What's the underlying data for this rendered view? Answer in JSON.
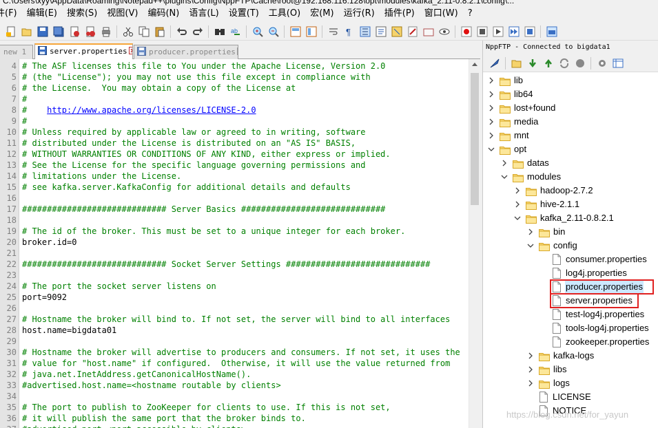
{
  "window": {
    "title": "C:\\Users\\xyy\\AppData\\Roaming\\Notepad++\\plugins\\Config\\NppFTP\\Cache\\root@192.168.116.128\\opt\\modules\\kafka_2.11-0.8.2.1\\config\\..."
  },
  "menu": [
    "件(F)",
    "编辑(E)",
    "搜索(S)",
    "视图(V)",
    "编码(N)",
    "语言(L)",
    "设置(T)",
    "工具(O)",
    "宏(M)",
    "运行(R)",
    "插件(P)",
    "窗口(W)",
    "?"
  ],
  "tabs": [
    {
      "label": "new 1",
      "active": false
    },
    {
      "label": "server.properties",
      "active": true
    },
    {
      "label": "producer.properties",
      "active": false
    }
  ],
  "editor": {
    "lines": [
      {
        "n": "4",
        "text": "# The ASF licenses this file to You under the Apache License, Version 2.0",
        "kind": "comment"
      },
      {
        "n": "5",
        "text": "# (the \"License\"); you may not use this file except in compliance with",
        "kind": "comment"
      },
      {
        "n": "6",
        "text": "# the License.  You may obtain a copy of the License at",
        "kind": "comment"
      },
      {
        "n": "7",
        "text": "#",
        "kind": "comment"
      },
      {
        "n": "8",
        "text": "#    ",
        "kind": "url",
        "url": "http://www.apache.org/licenses/LICENSE-2.0"
      },
      {
        "n": "9",
        "text": "#",
        "kind": "comment"
      },
      {
        "n": "10",
        "text": "# Unless required by applicable law or agreed to in writing, software",
        "kind": "comment"
      },
      {
        "n": "11",
        "text": "# distributed under the License is distributed on an \"AS IS\" BASIS,",
        "kind": "comment"
      },
      {
        "n": "12",
        "text": "# WITHOUT WARRANTIES OR CONDITIONS OF ANY KIND, either express or implied.",
        "kind": "comment"
      },
      {
        "n": "13",
        "text": "# See the License for the specific language governing permissions and",
        "kind": "comment"
      },
      {
        "n": "14",
        "text": "# limitations under the License.",
        "kind": "comment"
      },
      {
        "n": "15",
        "text": "# see kafka.server.KafkaConfig for additional details and defaults",
        "kind": "comment"
      },
      {
        "n": "16",
        "text": "",
        "kind": "plain"
      },
      {
        "n": "17",
        "text": "############################# Server Basics #############################",
        "kind": "comment"
      },
      {
        "n": "18",
        "text": "",
        "kind": "plain"
      },
      {
        "n": "19",
        "text": "# The id of the broker. This must be set to a unique integer for each broker.",
        "kind": "comment"
      },
      {
        "n": "20",
        "text": "broker.id=0",
        "kind": "plain"
      },
      {
        "n": "21",
        "text": "",
        "kind": "plain"
      },
      {
        "n": "22",
        "text": "############################# Socket Server Settings #############################",
        "kind": "comment"
      },
      {
        "n": "23",
        "text": "",
        "kind": "plain"
      },
      {
        "n": "24",
        "text": "# The port the socket server listens on",
        "kind": "comment"
      },
      {
        "n": "25",
        "text": "port=9092",
        "kind": "plain"
      },
      {
        "n": "26",
        "text": "",
        "kind": "plain"
      },
      {
        "n": "27",
        "text": "# Hostname the broker will bind to. If not set, the server will bind to all interfaces",
        "kind": "comment"
      },
      {
        "n": "28",
        "text": "host.name=bigdata01",
        "kind": "plain"
      },
      {
        "n": "29",
        "text": "",
        "kind": "plain"
      },
      {
        "n": "30",
        "text": "# Hostname the broker will advertise to producers and consumers. If not set, it uses the",
        "kind": "comment"
      },
      {
        "n": "31",
        "text": "# value for \"host.name\" if configured.  Otherwise, it will use the value returned from",
        "kind": "comment"
      },
      {
        "n": "32",
        "text": "# java.net.InetAddress.getCanonicalHostName().",
        "kind": "comment"
      },
      {
        "n": "33",
        "text": "#advertised.host.name=<hostname routable by clients>",
        "kind": "comment"
      },
      {
        "n": "34",
        "text": "",
        "kind": "plain"
      },
      {
        "n": "35",
        "text": "# The port to publish to ZooKeeper for clients to use. If this is not set,",
        "kind": "comment"
      },
      {
        "n": "36",
        "text": "# it will publish the same port that the broker binds to.",
        "kind": "comment"
      },
      {
        "n": "37",
        "text": "#advertised.port=<port accessible by clients>",
        "kind": "comment"
      }
    ]
  },
  "ftp": {
    "header": "NppFTP - Connected to bigdata1",
    "tree": [
      {
        "label": "lib",
        "type": "folder",
        "depth": 0,
        "expanded": false
      },
      {
        "label": "lib64",
        "type": "folder",
        "depth": 0,
        "expanded": false
      },
      {
        "label": "lost+found",
        "type": "folder",
        "depth": 0,
        "expanded": false
      },
      {
        "label": "media",
        "type": "folder",
        "depth": 0,
        "expanded": false
      },
      {
        "label": "mnt",
        "type": "folder",
        "depth": 0,
        "expanded": false
      },
      {
        "label": "opt",
        "type": "folder",
        "depth": 0,
        "expanded": true
      },
      {
        "label": "datas",
        "type": "folder",
        "depth": 1,
        "expanded": false
      },
      {
        "label": "modules",
        "type": "folder",
        "depth": 1,
        "expanded": true
      },
      {
        "label": "hadoop-2.7.2",
        "type": "folder",
        "depth": 2,
        "expanded": false
      },
      {
        "label": "hive-2.1.1",
        "type": "folder",
        "depth": 2,
        "expanded": false
      },
      {
        "label": "kafka_2.11-0.8.2.1",
        "type": "folder",
        "depth": 2,
        "expanded": true
      },
      {
        "label": "bin",
        "type": "folder",
        "depth": 3,
        "expanded": false
      },
      {
        "label": "config",
        "type": "folder",
        "depth": 3,
        "expanded": true
      },
      {
        "label": "consumer.properties",
        "type": "file",
        "depth": 4
      },
      {
        "label": "log4j.properties",
        "type": "file",
        "depth": 4
      },
      {
        "label": "producer.properties",
        "type": "file",
        "depth": 4,
        "selected": true,
        "highlight": true
      },
      {
        "label": "server.properties",
        "type": "file",
        "depth": 4,
        "highlight": true
      },
      {
        "label": "test-log4j.properties",
        "type": "file",
        "depth": 4
      },
      {
        "label": "tools-log4j.properties",
        "type": "file",
        "depth": 4
      },
      {
        "label": "zookeeper.properties",
        "type": "file",
        "depth": 4
      },
      {
        "label": "kafka-logs",
        "type": "folder",
        "depth": 3,
        "expanded": false
      },
      {
        "label": "libs",
        "type": "folder",
        "depth": 3,
        "expanded": false
      },
      {
        "label": "logs",
        "type": "folder",
        "depth": 3,
        "expanded": false
      },
      {
        "label": "LICENSE",
        "type": "file",
        "depth": 3
      },
      {
        "label": "NOTICE",
        "type": "file",
        "depth": 3
      }
    ]
  },
  "watermark": "https://blog.csdn.net/for_yayun",
  "colors": {
    "comment": "#008000",
    "url": "#0000ff",
    "highlight_box": "#e02020",
    "selection": "#cce8ff",
    "tab_accent": "#f7a63a"
  }
}
